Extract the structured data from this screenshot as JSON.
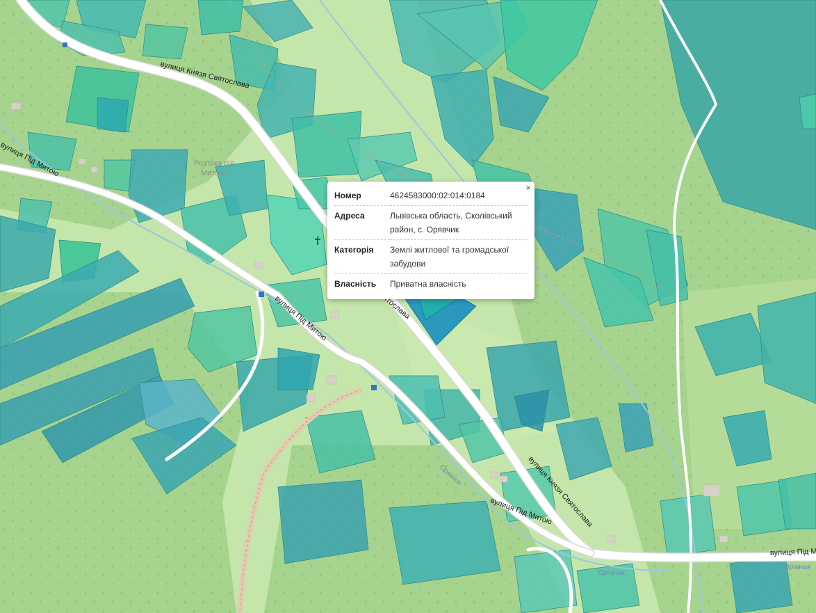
{
  "map": {
    "roads": [
      {
        "label": "вулиця Князя Святослава"
      },
      {
        "label": "вулиця Під Митою"
      },
      {
        "label": "вулиця Князя Святослава"
      },
      {
        "label": "вулиця Під Митою"
      },
      {
        "label": "Святослава"
      },
      {
        "label": "вулиця Під Митою"
      },
      {
        "label": "вулиця Під Ми"
      }
    ],
    "places": [
      {
        "label": "Розтока під"
      },
      {
        "label": "Митою"
      }
    ],
    "streams": [
      {
        "label": "Орявчик"
      },
      {
        "label": "Орявчик"
      },
      {
        "label": "Орявчик"
      }
    ],
    "colors": {
      "background": "#b9dea2",
      "forest": "#a6d48e",
      "parcel_green": "#3ec8a0",
      "parcel_teal": "#2aa5a8",
      "selected": "#1a8fc0",
      "road": "#ffffff"
    }
  },
  "popup": {
    "close_label": "×",
    "rows": [
      {
        "key": "Номер",
        "value": "4624583000:02:014:0184"
      },
      {
        "key": "Адреса",
        "value": "Львівська область, Сколівський район, с. Орявчик"
      },
      {
        "key": "Категорія",
        "value": "Землі житлової та громадської забудови"
      },
      {
        "key": "Власність",
        "value": "Приватна власність"
      }
    ]
  }
}
